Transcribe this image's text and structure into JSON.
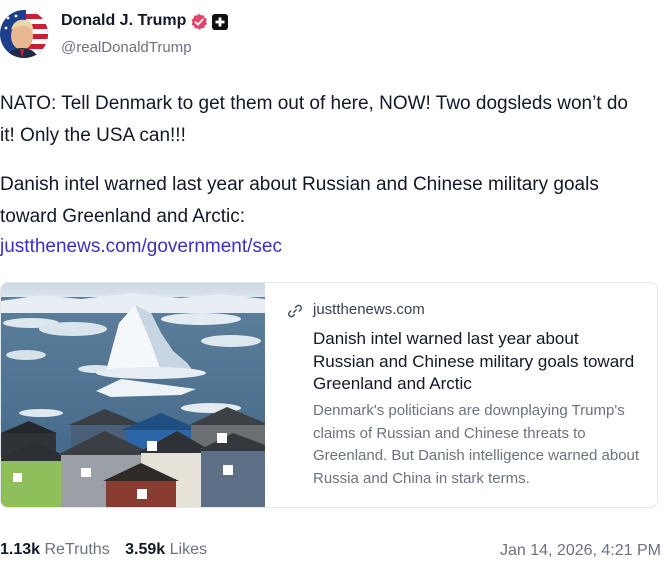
{
  "author": {
    "display_name": "Donald J. Trump",
    "handle": "@realDonaldTrump",
    "avatar_icon": "avatar-portrait-flag",
    "verified_icon": "verified-badge-icon",
    "verified_color": "#e3436b",
    "plus_icon": "plus-badge-icon"
  },
  "post": {
    "paragraph_1": "NATO: Tell Denmark to get them out of here, NOW! Two dogsleds won’t do it! Only the USA can!!!",
    "paragraph_2": "Danish intel warned last year about Russian and Chinese military goals toward Greenland and Arctic:",
    "link_text": "justthenews.com/government/sec",
    "link_color": "#3b2fc9"
  },
  "card": {
    "domain": "justthenews.com",
    "domain_icon": "link-icon",
    "title": "Danish intel warned last year about Russian and Chinese military goals toward Greenland and Arctic",
    "description": "Denmark's politicians are downplaying Trump's claims of Russian and Chinese threats to Greenland. But Danish intelligence warned about Russia and China in stark terms."
  },
  "stats": {
    "retruths_count": "1.13k",
    "retruths_label": "ReTruths",
    "likes_count": "3.59k",
    "likes_label": "Likes",
    "timestamp": "Jan 14, 2026, 4:21 PM"
  }
}
